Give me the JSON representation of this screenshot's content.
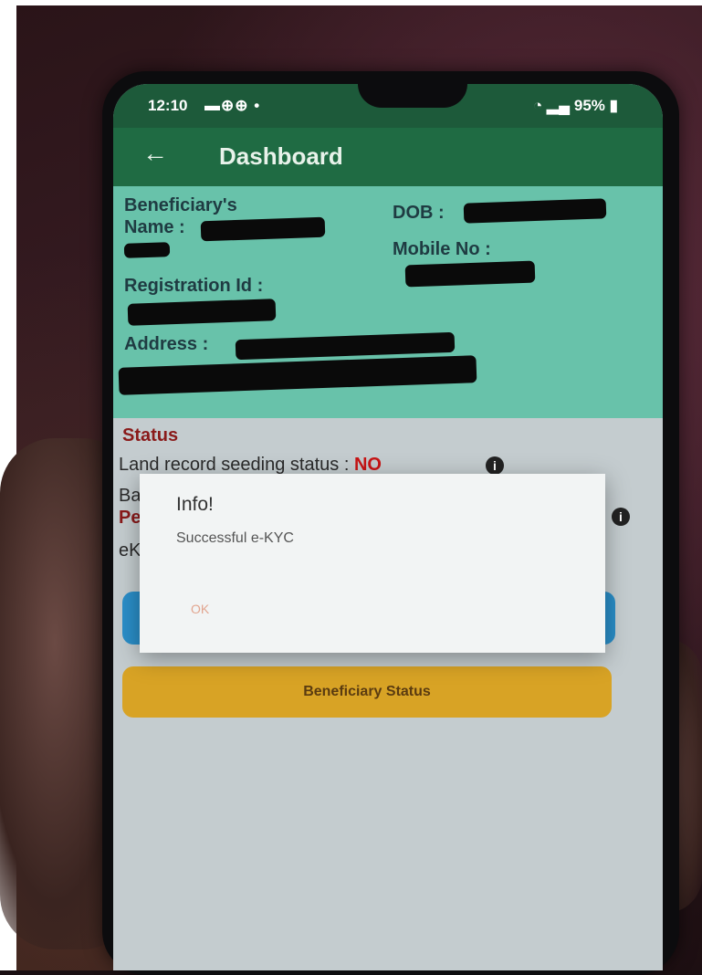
{
  "status_bar": {
    "time": "12:10",
    "notification_icons": "▬⊕⊕ •",
    "signal_battery": "95%"
  },
  "app_bar": {
    "title": "Dashboard"
  },
  "beneficiary": {
    "name_label_1": "Beneficiary's",
    "name_label_2": "Name :",
    "dob_label": "DOB :",
    "mobile_label": "Mobile No :",
    "registration_label": "Registration Id :",
    "address_label": "Address :"
  },
  "status": {
    "title": "Status",
    "land_record_label": "Land record seeding status :",
    "land_record_value": "NO",
    "row2_prefix": "Ba",
    "row3_prefix": "Pe",
    "row4_prefix": "eK"
  },
  "buttons": {
    "beneficiary_status": "Beneficiary Status"
  },
  "dialog": {
    "title": "Info!",
    "message": "Successful e-KYC",
    "ok_label": "OK"
  },
  "colors": {
    "app_bar": "#1f6b43",
    "info_card": "#68c2aa",
    "status_title": "#8a1a1a",
    "no_value": "#c81414",
    "blue_button": "#2a8ec8",
    "yellow_button": "#d8a325",
    "dialog_bg": "#f2f4f4",
    "ok_text": "#e2a58f"
  }
}
